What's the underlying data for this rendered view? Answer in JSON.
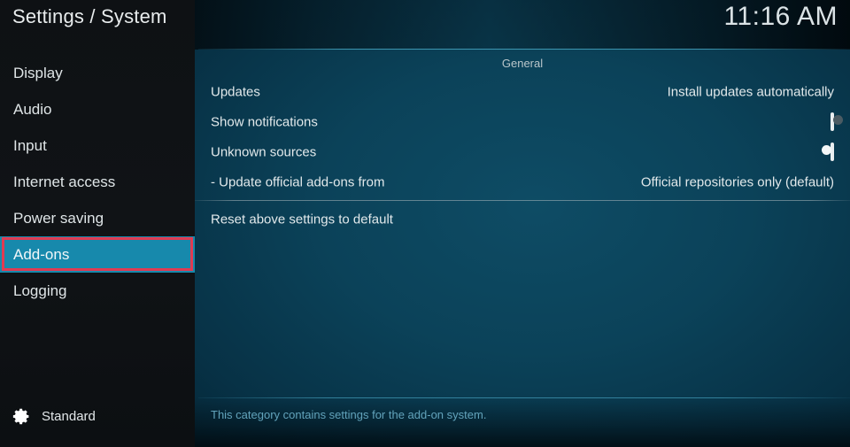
{
  "window": {
    "title": "Settings / System",
    "clock": "11:16 AM"
  },
  "sidebar": {
    "items": [
      {
        "label": "Display",
        "selected": false
      },
      {
        "label": "Audio",
        "selected": false
      },
      {
        "label": "Input",
        "selected": false
      },
      {
        "label": "Internet access",
        "selected": false
      },
      {
        "label": "Power saving",
        "selected": false
      },
      {
        "label": "Add-ons",
        "selected": true
      },
      {
        "label": "Logging",
        "selected": false
      }
    ],
    "footer": {
      "icon": "gear-icon",
      "level_label": "Standard"
    }
  },
  "content": {
    "group_title": "General",
    "rows": [
      {
        "label": "Updates",
        "type": "value",
        "value": "Install updates automatically"
      },
      {
        "label": "Show notifications",
        "type": "toggle",
        "toggle_state": "off"
      },
      {
        "label": "Unknown sources",
        "type": "toggle",
        "toggle_state": "on"
      },
      {
        "label": "- Update official add-ons from",
        "type": "value",
        "value": "Official repositories only (default)"
      },
      {
        "label": "Reset above settings to default",
        "type": "action",
        "value": ""
      }
    ]
  },
  "help": {
    "text": "This category contains settings for the add-on system."
  },
  "annotation": {
    "highlight_target": "Add-ons",
    "border_color": "#e03b52"
  },
  "colors": {
    "accent_teal": "#1789ac",
    "panel_center": "#0b4259",
    "panel_edge": "#011720",
    "sidebar_bg": "#101316",
    "text_primary": "#e2e9eb",
    "help_text": "#62a3bb",
    "annotation_red": "#e03b52"
  }
}
